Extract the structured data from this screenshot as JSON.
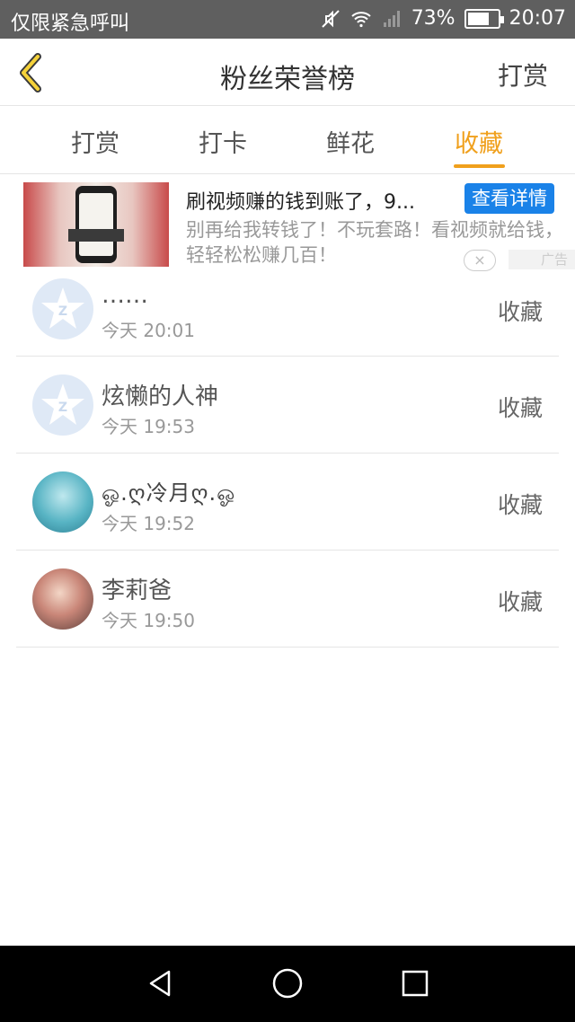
{
  "status_bar": {
    "carrier": "仅限紧急呼叫",
    "battery": "73%",
    "battery_level": 0.73,
    "time": "20:07",
    "icons": [
      "mute-icon",
      "wifi-icon",
      "signal-icon",
      "battery-icon"
    ]
  },
  "nav": {
    "title": "粉丝荣誉榜",
    "action": "打赏",
    "back_icon": "chevron-left-icon"
  },
  "tabs": [
    {
      "label": "打赏",
      "active": false
    },
    {
      "label": "打卡",
      "active": false
    },
    {
      "label": "鲜花",
      "active": false
    },
    {
      "label": "收藏",
      "active": true
    }
  ],
  "ad": {
    "title": "刷视频赚的钱到账了，9...",
    "button": "查看详情",
    "description": "别再给我转钱了！不玩套路！看视频就给钱，轻轻松松赚几百！",
    "badge": "广告",
    "close": "×"
  },
  "fans": [
    {
      "name": "……",
      "time": "今天 20:01",
      "action": "收藏",
      "avatar": "default-avatar"
    },
    {
      "name": "炫懒的人神",
      "time": "今天 19:53",
      "action": "收藏",
      "avatar": "default-avatar"
    },
    {
      "name": "ஓ.ღ冷月ღ.ஓ",
      "time": "今天 19:52",
      "action": "收藏",
      "avatar": "anime-avatar"
    },
    {
      "name": "李莉爸",
      "time": "今天 19:50",
      "action": "收藏",
      "avatar": "photo-avatar"
    }
  ],
  "colors": {
    "accent": "#f0a01c",
    "status_bar": "#5f5f5f",
    "ad_button": "#1a82e8"
  }
}
